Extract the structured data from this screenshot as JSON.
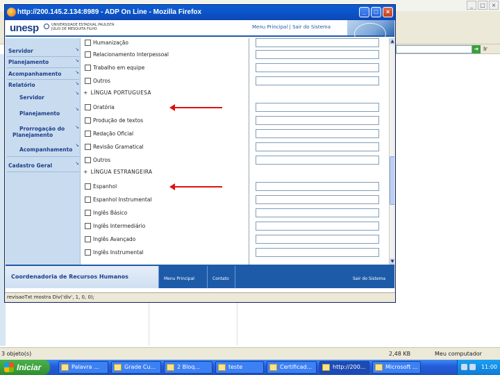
{
  "background_window": {
    "address_go_label": "Ir",
    "status_text": "3 objeto(s)",
    "status_size": "2,48 KB",
    "status_zone": "Meu computador"
  },
  "firefox": {
    "title": "http://200.145.2.134:8989 - ADP On Line - Mozilla Firefox",
    "status_text": "revisaoTxt mostra Div('div', 1, 0, 0);"
  },
  "header": {
    "logo": "unesp",
    "university_line1": "UNIVERSIDADE ESTADUAL PAULISTA",
    "university_line2": "JÚLIO DE MESQUITA FILHO",
    "links": "Menu Principal | Sair do Sistema"
  },
  "side_menu": {
    "items": [
      {
        "label": "Servidor"
      },
      {
        "label": "Planejamento"
      },
      {
        "label": "Acompanhamento"
      },
      {
        "label": "Relatório"
      },
      {
        "label": "Servidor"
      },
      {
        "label": "Planejamento"
      },
      {
        "label": "Prorrogação do"
      },
      {
        "label": "Planejamento"
      },
      {
        "label": "Acompanhamento"
      },
      {
        "label": "Cadastro Geral"
      }
    ]
  },
  "main": {
    "rows_top": [
      {
        "label": "Humanização"
      },
      {
        "label": "Relacionamento Interpessoal"
      },
      {
        "label": "Trabalho em equipe"
      },
      {
        "label": "Outros"
      }
    ],
    "section_portuguese": "LÍNGUA PORTUGUESA",
    "rows_portuguese": [
      {
        "label": "Oratória"
      },
      {
        "label": "Produção de textos"
      },
      {
        "label": "Redação Oficial"
      },
      {
        "label": "Revisão Gramatical"
      },
      {
        "label": "Outros"
      }
    ],
    "section_foreign": "LÍNGUA ESTRANGEIRA",
    "rows_foreign": [
      {
        "label": "Espanhol"
      },
      {
        "label": "Espanhol Instrumental"
      },
      {
        "label": "Inglês Básico"
      },
      {
        "label": "Inglês Intermediário"
      },
      {
        "label": "Inglês Avançado"
      },
      {
        "label": "Inglês Instrumental"
      }
    ]
  },
  "footer": {
    "title": "Coordenadoria de Recursos Humanos",
    "link_menu": "Menu Principal",
    "link_contact": "Contato",
    "link_exit": "Sair do Sistema"
  },
  "taskbar": {
    "start_label": "Iniciar",
    "items": [
      {
        "label": "Palavra ..."
      },
      {
        "label": "Grade Cu..."
      },
      {
        "label": "2 Bloq..."
      },
      {
        "label": "teste"
      },
      {
        "label": "Certificad..."
      },
      {
        "label": "http://200..."
      },
      {
        "label": "Microsoft ..."
      }
    ],
    "clock": "11:00"
  },
  "colors": {
    "accent": "#1d5ba8",
    "menu_bg": "#c9dcef",
    "arrow": "#e01010"
  }
}
